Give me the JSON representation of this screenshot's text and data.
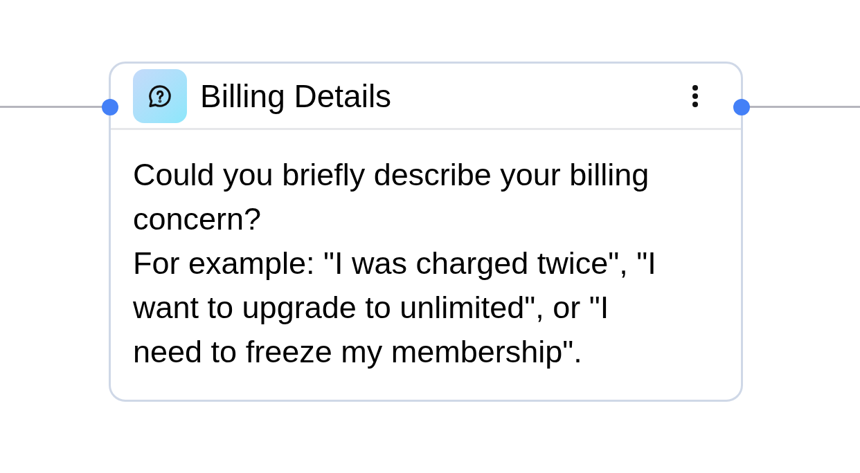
{
  "node": {
    "title": "Billing Details",
    "message": [
      "Could you briefly describe your billing concern?",
      "For example: \"I was charged twice\", \"I want to upgrade to unlimited\", or \"I need to freeze my membership\"."
    ]
  }
}
